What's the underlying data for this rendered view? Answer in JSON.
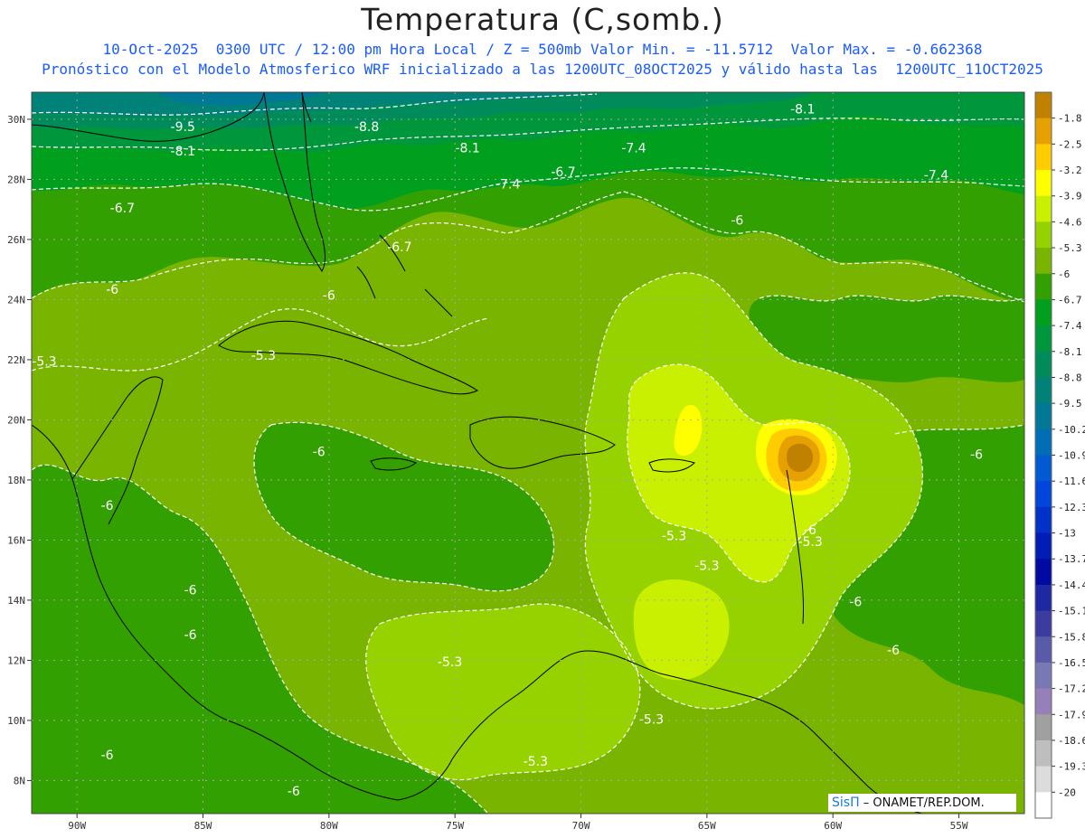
{
  "title": "Temperatura (C,somb.)",
  "subtitle_line1": "10-Oct-2025  0300 UTC / 12:00 pm Hora Local / Z = 500mb Valor Min. = -11.5712  Valor Max. = -0.662368",
  "subtitle_line2": "Pronóstico con el Modelo Atmosferico WRF inicializado a las 1200UTC_08OCT2025 y válido hasta las  1200UTC_11OCT2025",
  "credit": {
    "brand": "SisΠ",
    "text": "– ONAMET/REP.DOM."
  },
  "latitude_labels": [
    "30N",
    "28N",
    "26N",
    "24N",
    "22N",
    "20N",
    "18N",
    "16N",
    "14N",
    "12N",
    "10N",
    "8N"
  ],
  "longitude_labels": [
    "90W",
    "85W",
    "80W",
    "75W",
    "70W",
    "65W",
    "60W",
    "55W"
  ],
  "legend": [
    {
      "label": "-1.8",
      "color": "#c08000"
    },
    {
      "label": "-2.5",
      "color": "#e6a000"
    },
    {
      "label": "-3.2",
      "color": "#ffcc00"
    },
    {
      "label": "-3.9",
      "color": "#ffff00"
    },
    {
      "label": "-4.6",
      "color": "#c8f000"
    },
    {
      "label": "-5.3",
      "color": "#96d200"
    },
    {
      "label": "-6",
      "color": "#78b400"
    },
    {
      "label": "-6.7",
      "color": "#32a000"
    },
    {
      "label": "-7.4",
      "color": "#009f1e"
    },
    {
      "label": "-8.1",
      "color": "#00963c"
    },
    {
      "label": "-8.8",
      "color": "#008c5a"
    },
    {
      "label": "-9.5",
      "color": "#008278"
    },
    {
      "label": "-10.2",
      "color": "#007896"
    },
    {
      "label": "-10.9",
      "color": "#006eb4"
    },
    {
      "label": "-11.6",
      "color": "#005ad2"
    },
    {
      "label": "-12.3",
      "color": "#0046dc"
    },
    {
      "label": "-13",
      "color": "#0032c8"
    },
    {
      "label": "-13.7",
      "color": "#001eb4"
    },
    {
      "label": "-14.4",
      "color": "#000aa0"
    },
    {
      "label": "-15.1",
      "color": "#1e28a0"
    },
    {
      "label": "-15.8",
      "color": "#3c3ca0"
    },
    {
      "label": "-16.5",
      "color": "#5a5aaa"
    },
    {
      "label": "-17.2",
      "color": "#7878b4"
    },
    {
      "label": "-17.9",
      "color": "#9680b9"
    },
    {
      "label": "-18.6",
      "color": "#a0a0a0"
    },
    {
      "label": "-19.3",
      "color": "#bebebe"
    },
    {
      "label": "-20",
      "color": "#dcdcdc"
    },
    {
      "label": "",
      "color": "#ffffff"
    }
  ],
  "contour_labels": [
    {
      "text": "-9.5",
      "lon": -85.8,
      "lat": 29.6
    },
    {
      "text": "-8.8",
      "lon": -78.5,
      "lat": 29.6
    },
    {
      "text": "-8.1",
      "lon": -74.5,
      "lat": 28.9
    },
    {
      "text": "-8.1",
      "lon": -85.8,
      "lat": 28.8
    },
    {
      "text": "-8.1",
      "lon": -61.2,
      "lat": 30.2
    },
    {
      "text": "-7.4",
      "lon": -72.9,
      "lat": 27.7
    },
    {
      "text": "-7.4",
      "lon": -67.9,
      "lat": 28.9
    },
    {
      "text": "-7.4",
      "lon": -55.9,
      "lat": 28.0
    },
    {
      "text": "-6.7",
      "lon": -88.2,
      "lat": 26.9
    },
    {
      "text": "-6.7",
      "lon": -70.7,
      "lat": 28.1
    },
    {
      "text": "-6.7",
      "lon": -77.2,
      "lat": 25.6
    },
    {
      "text": "-6",
      "lon": -88.6,
      "lat": 24.2
    },
    {
      "text": "-6",
      "lon": -80.0,
      "lat": 24.0
    },
    {
      "text": "-6",
      "lon": -63.8,
      "lat": 26.5
    },
    {
      "text": "-6",
      "lon": -80.4,
      "lat": 18.8
    },
    {
      "text": "-6",
      "lon": -88.8,
      "lat": 17.0
    },
    {
      "text": "-6",
      "lon": -85.5,
      "lat": 14.2
    },
    {
      "text": "-6",
      "lon": -85.5,
      "lat": 12.7
    },
    {
      "text": "-6",
      "lon": -88.8,
      "lat": 8.7
    },
    {
      "text": "-6",
      "lon": -81.4,
      "lat": 7.5
    },
    {
      "text": "-6",
      "lon": -59.1,
      "lat": 13.8
    },
    {
      "text": "-6",
      "lon": -57.6,
      "lat": 12.2
    },
    {
      "text": "-6",
      "lon": -60.9,
      "lat": 16.2
    },
    {
      "text": "-6",
      "lon": -54.3,
      "lat": 18.7
    },
    {
      "text": "-5.3",
      "lon": -91.3,
      "lat": 21.8
    },
    {
      "text": "-5.3",
      "lon": -82.6,
      "lat": 22.0
    },
    {
      "text": "-5.3",
      "lon": -75.2,
      "lat": 11.8
    },
    {
      "text": "-5.3",
      "lon": -71.8,
      "lat": 8.5
    },
    {
      "text": "-5.3",
      "lon": -67.2,
      "lat": 9.9
    },
    {
      "text": "-5.3",
      "lon": -66.3,
      "lat": 16.0
    },
    {
      "text": "-5.3",
      "lon": -65.0,
      "lat": 15.0
    },
    {
      "text": "-5.3",
      "lon": -60.9,
      "lat": 15.8
    }
  ]
}
